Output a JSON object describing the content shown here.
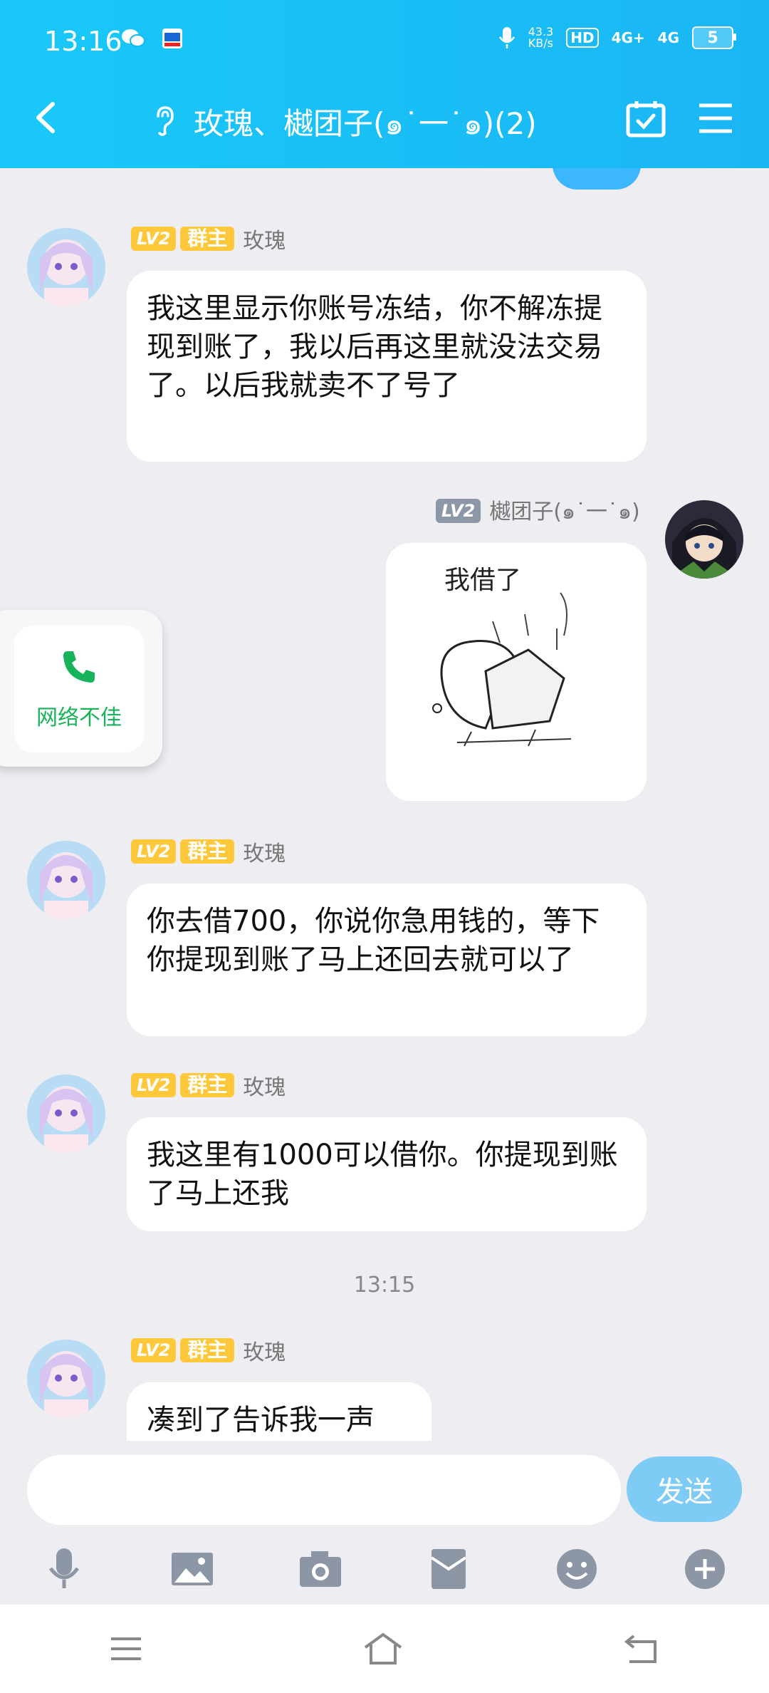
{
  "status_bar": {
    "time": "13:16",
    "net_speed_top": "43.3",
    "net_speed_bottom": "KB/s",
    "hd_label": "HD",
    "sim1": "4G+",
    "sim2": "4G",
    "battery": "5"
  },
  "header": {
    "title": "玫瑰、樾团子(๑˙一˙๑)(2)"
  },
  "messages": [
    {
      "level": "LV2",
      "role": "群主",
      "name": "玫瑰",
      "text": "我这里显示你账号冻结，你不解冻提现到账了，我以后再这里就没法交易了。以后我就卖不了号了"
    },
    {
      "level": "LV2",
      "name": "樾团子(๑˙一˙๑)",
      "sticker_text": "我借了"
    },
    {
      "level": "LV2",
      "role": "群主",
      "name": "玫瑰",
      "text": "你去借700，你说你急用钱的，等下你提现到账了马上还回去就可以了"
    },
    {
      "level": "LV2",
      "role": "群主",
      "name": "玫瑰",
      "text": "我这里有1000可以借你。你提现到账了马上还我"
    },
    {
      "level": "LV2",
      "role": "群主",
      "name": "玫瑰",
      "text": "凑到了告诉我一声"
    }
  ],
  "time_separator": "13:15",
  "call_widget": {
    "label": "网络不佳"
  },
  "input": {
    "placeholder": "",
    "send_label": "发送"
  },
  "colors": {
    "accent": "#1ab6f4",
    "badge": "#ffc83a",
    "call_green": "#17b35b"
  }
}
